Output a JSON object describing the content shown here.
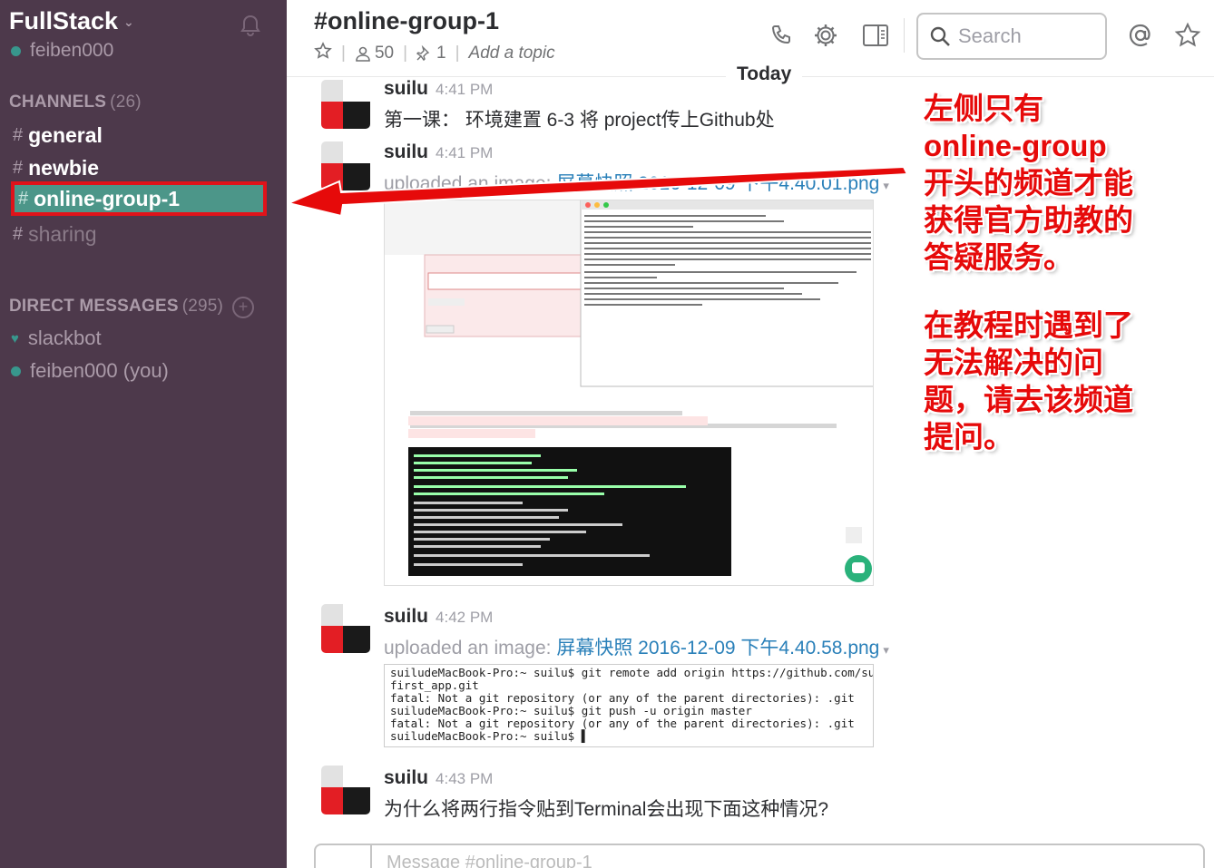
{
  "sidebar": {
    "team_name": "FullStack",
    "user": "feiben000",
    "channels_header": "CHANNELS",
    "channels_count": "(26)",
    "channels": [
      {
        "label": "general"
      },
      {
        "label": "newbie"
      },
      {
        "label": "online-group-1"
      },
      {
        "label": "sharing"
      }
    ],
    "dm_header": "DIRECT MESSAGES",
    "dm_count": "(295)",
    "dms": [
      {
        "label": "slackbot"
      },
      {
        "label": "feiben000 (you)"
      }
    ]
  },
  "header": {
    "channel_title": "#online-group-1",
    "members": "50",
    "pins": "1",
    "topic_placeholder": "Add a topic",
    "search_placeholder": "Search"
  },
  "day_divider": "Today",
  "messages": [
    {
      "author": "suilu",
      "time": "4:41 PM",
      "text": "第一课：  环境建置   6-3 将 project传上Github处"
    },
    {
      "author": "suilu",
      "time": "4:41 PM",
      "prefix": "uploaded an image:",
      "file": "屏幕快照 2016-12-09 下午4.40.01.png"
    },
    {
      "author": "suilu",
      "time": "4:42 PM",
      "prefix": "uploaded an image:",
      "file": "屏幕快照 2016-12-09 下午4.40.58.png"
    },
    {
      "author": "suilu",
      "time": "4:43 PM",
      "text": "为什么将两行指令贴到Terminal会出现下面这种情况?"
    }
  ],
  "screenshot_image": {
    "page_title": "Rails 第一课：环境建置",
    "push_heading": "...or push an existing repository from the command line",
    "import_heading": "...or import code from another repository",
    "section": "2.上传专案",
    "instruction": "接着我们将 Github 好心帮我们准备的两行指令，贴到 Terminal 去。",
    "cmd1": "git remote add origin git@github.com:xxddite/first_app.git",
    "cmd1_note": "（这边改成 Github 提供给你的网址）",
    "cmd2": "git push -u origin master",
    "terminal_title": "suilu — -bash — 80×24"
  },
  "terminal_output": [
    "suiludeMacBook-Pro:~ suilu$ git remote add origin https://github.com/suilu/",
    "first_app.git",
    "fatal: Not a git repository (or any of the parent directories): .git",
    "suiludeMacBook-Pro:~ suilu$ git push -u origin master",
    "fatal: Not a git repository (or any of the parent directories): .git",
    "suiludeMacBook-Pro:~ suilu$ ▌"
  ],
  "composer": {
    "placeholder": "Message #online-group-1"
  },
  "annotation": {
    "lines_1": [
      "左侧只有",
      "online-group",
      "开头的频道才能",
      "获得官方助教的",
      "答疑服务。"
    ],
    "lines_2": [
      "在教程时遇到了",
      "无法解决的问",
      "题，请去该频道",
      "提问。"
    ]
  },
  "colors": {
    "sidebar_bg": "#4d394b",
    "active_channel_bg": "#4c9689",
    "annotation_red": "#e60a0a",
    "link_blue": "#2a80b9",
    "presence_green": "#38978d"
  },
  "icons": [
    "bell-icon",
    "user-icon",
    "pin-icon",
    "star-icon",
    "phone-icon",
    "gear-icon",
    "sidebar-toggle-icon",
    "search-icon",
    "at-icon",
    "plus-icon",
    "heart-icon"
  ]
}
